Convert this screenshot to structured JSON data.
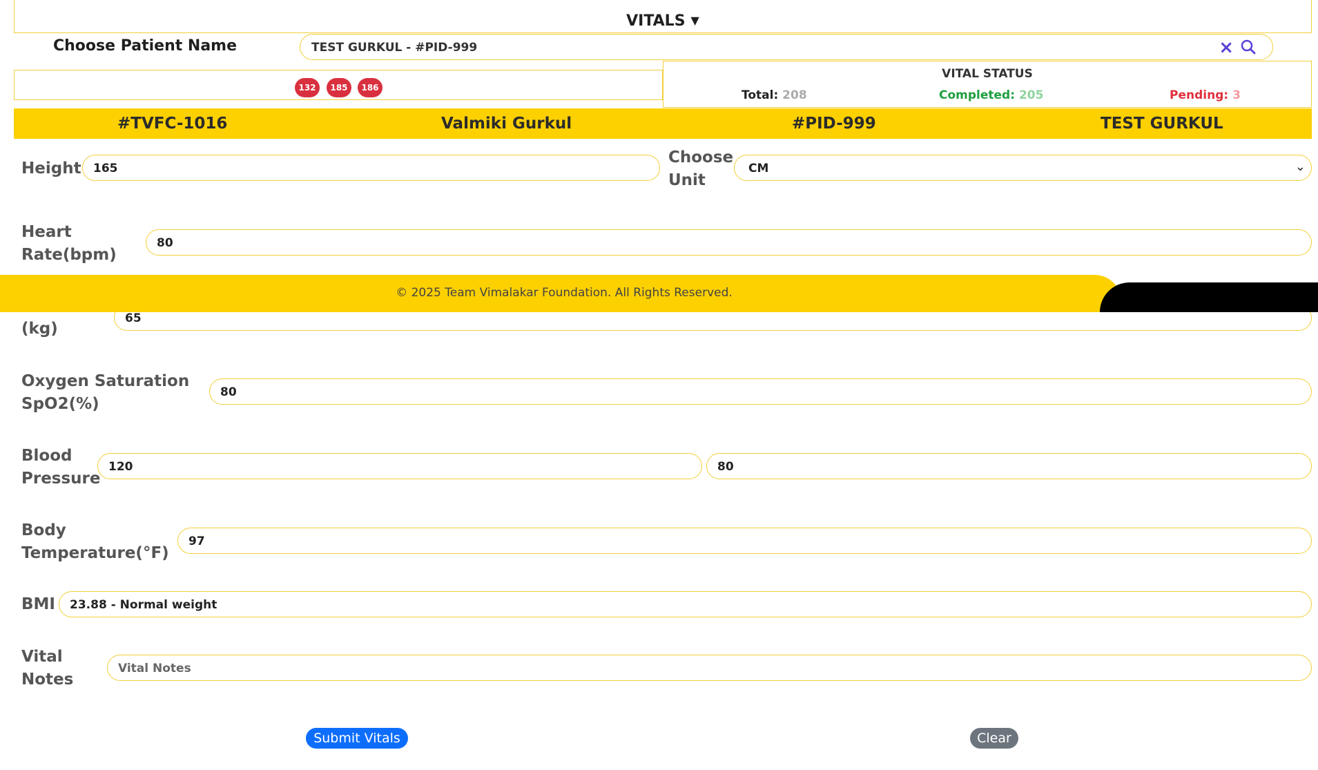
{
  "header": {
    "title": "VITALS",
    "caret_icon": "caret-down-icon"
  },
  "patient_select": {
    "label": "Choose Patient Name",
    "value": "TEST GURKUL - #PID-999"
  },
  "badges": [
    "132",
    "185",
    "186"
  ],
  "vital_status": {
    "title": "VITAL STATUS",
    "total_label": "Total:",
    "total_value": "208",
    "completed_label": "Completed:",
    "completed_value": "205",
    "pending_label": "Pending:",
    "pending_value": "3"
  },
  "patient_bar": {
    "camp_id": "#TVFC-1016",
    "camp_name": "Valmiki Gurkul",
    "patient_id": "#PID-999",
    "patient_name": "TEST GURKUL"
  },
  "fields": {
    "height": {
      "label": "Height",
      "value": "165"
    },
    "unit": {
      "label_line1": "Choose",
      "label_line2": "Unit",
      "value": "CM"
    },
    "heart_rate": {
      "label_line1": "Heart",
      "label_line2": "Rate(bpm)",
      "value": "80"
    },
    "weight": {
      "label_line2": "(kg)",
      "value": "65"
    },
    "spo2": {
      "label_line1": "Oxygen Saturation",
      "label_line2": "SpO2(%)",
      "value": "80"
    },
    "blood_pressure": {
      "label_line1": "Blood",
      "label_line2": "Pressure",
      "systolic": "120",
      "diastolic": "80"
    },
    "temperature": {
      "label_line1": "Body",
      "label_line2": "Temperature(°F)",
      "value": "97"
    },
    "bmi": {
      "label": "BMI",
      "value": "23.88 - Normal weight"
    },
    "notes": {
      "label_line1": "Vital",
      "label_line2": "Notes",
      "placeholder": "Vital Notes"
    }
  },
  "footer": {
    "text": "© 2025 Team Vimalakar Foundation. All Rights Reserved."
  },
  "actions": {
    "submit_label": "Submit Vitals",
    "clear_label": "Clear"
  },
  "colors": {
    "accent_yellow": "#fdd000",
    "border_yellow": "#f3cf3a",
    "badge_red": "#d9303f",
    "completed_green": "#1e9e3e",
    "pending_red": "#e0303c",
    "primary_blue": "#0d6efd",
    "icon_purple": "#5b3fd6"
  }
}
